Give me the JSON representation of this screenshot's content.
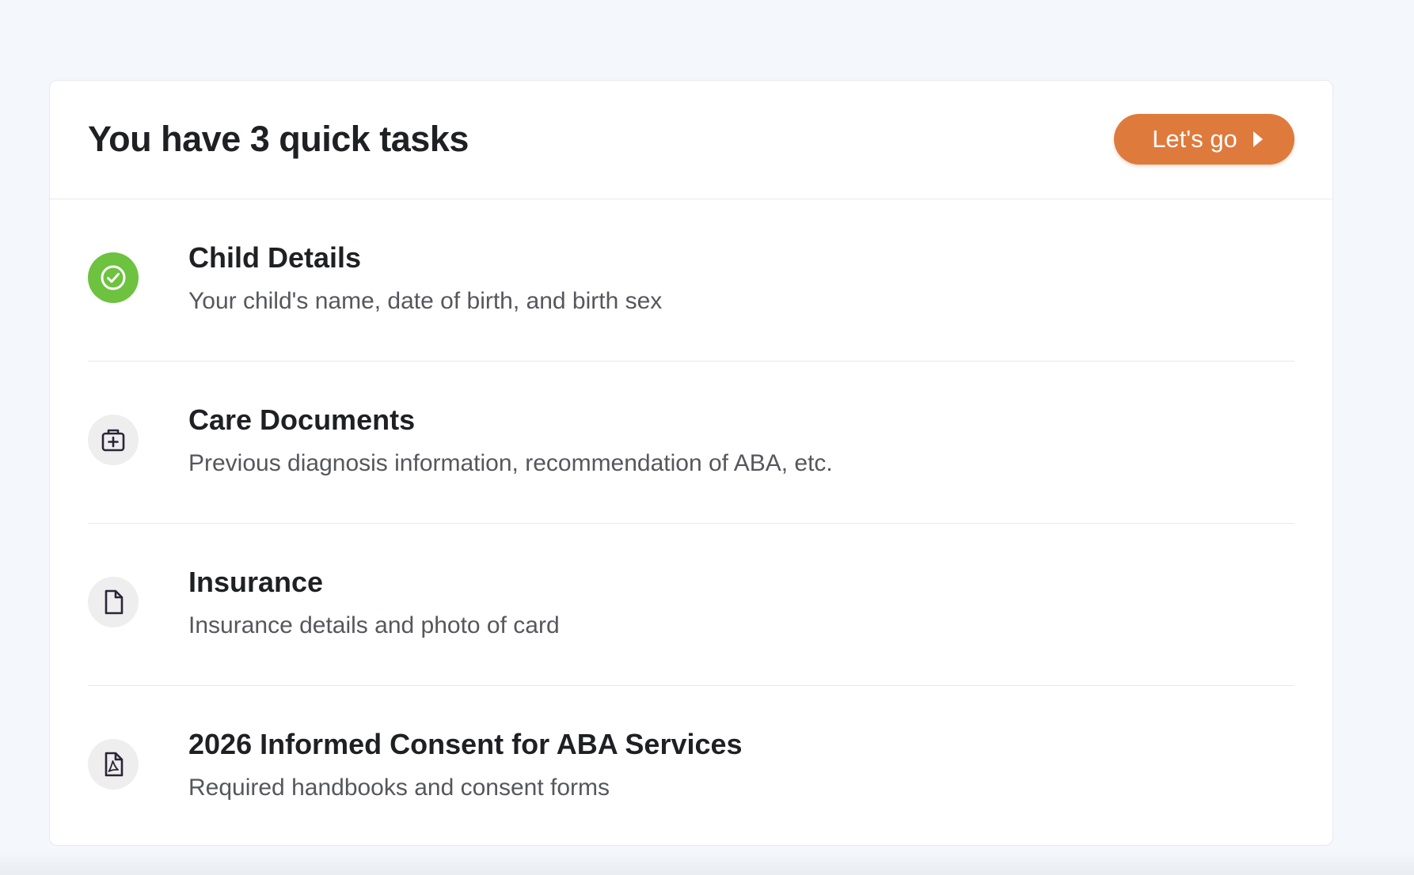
{
  "header": {
    "title": "You have 3 quick tasks",
    "cta_label": "Let's go"
  },
  "tasks": [
    {
      "title": "Child Details",
      "description": "Your child's name, date of birth, and birth sex",
      "icon": "check-circle-icon",
      "status": "complete"
    },
    {
      "title": "Care Documents",
      "description": "Previous diagnosis information, recommendation of ABA, etc.",
      "icon": "medical-kit-icon",
      "status": "pending"
    },
    {
      "title": "Insurance",
      "description": "Insurance details and photo of card",
      "icon": "document-icon",
      "status": "pending"
    },
    {
      "title": "2026 Informed Consent for ABA Services",
      "description": "Required handbooks and consent forms",
      "icon": "pdf-document-icon",
      "status": "pending"
    }
  ],
  "colors": {
    "accent": "#df7a3d",
    "success": "#6dc240",
    "background": "#f4f7fb"
  }
}
